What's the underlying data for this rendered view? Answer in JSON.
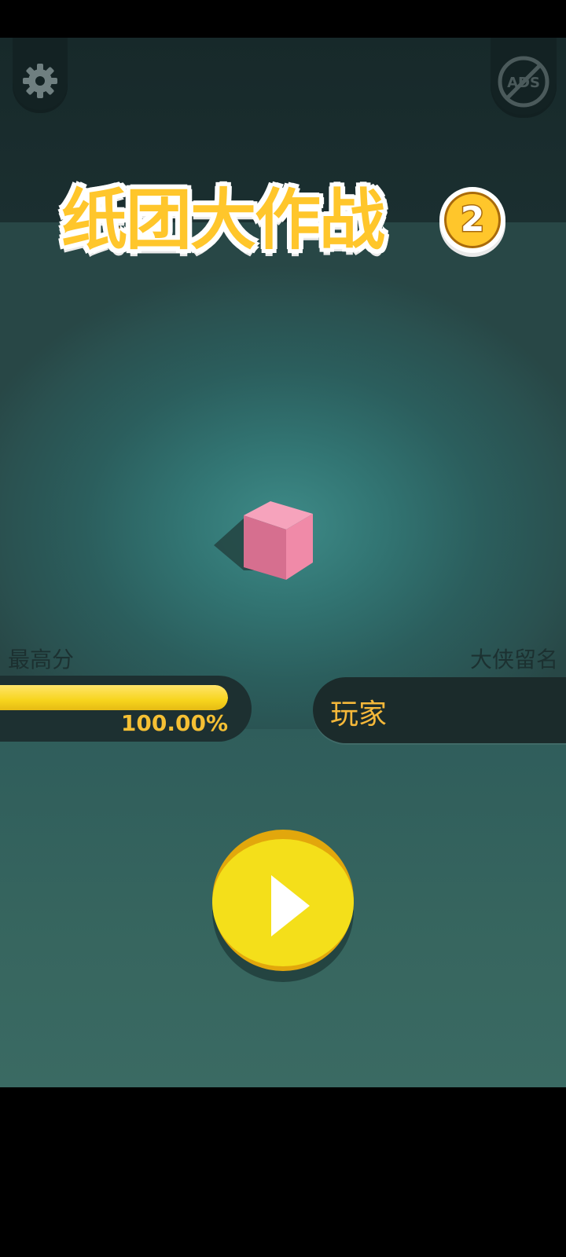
{
  "app": {
    "title_main": "纸团大作战",
    "title_badge": "2"
  },
  "toolbar": {
    "settings_icon": "gear-icon",
    "no_ads_icon": "no-ads-icon",
    "no_ads_text": "ADS"
  },
  "stats": {
    "best_score_label": "最高分",
    "best_score_progress": 1.0,
    "best_score_text": "100.00%",
    "hero_label": "大侠留名",
    "player_name": "玩家"
  },
  "play": {
    "icon": "play-icon"
  },
  "colors": {
    "accent_yellow": "#f4df1a",
    "title_orange": "#ffc62b",
    "cube_pink": "#f28aa8",
    "panel_dark": "#1d3031"
  }
}
